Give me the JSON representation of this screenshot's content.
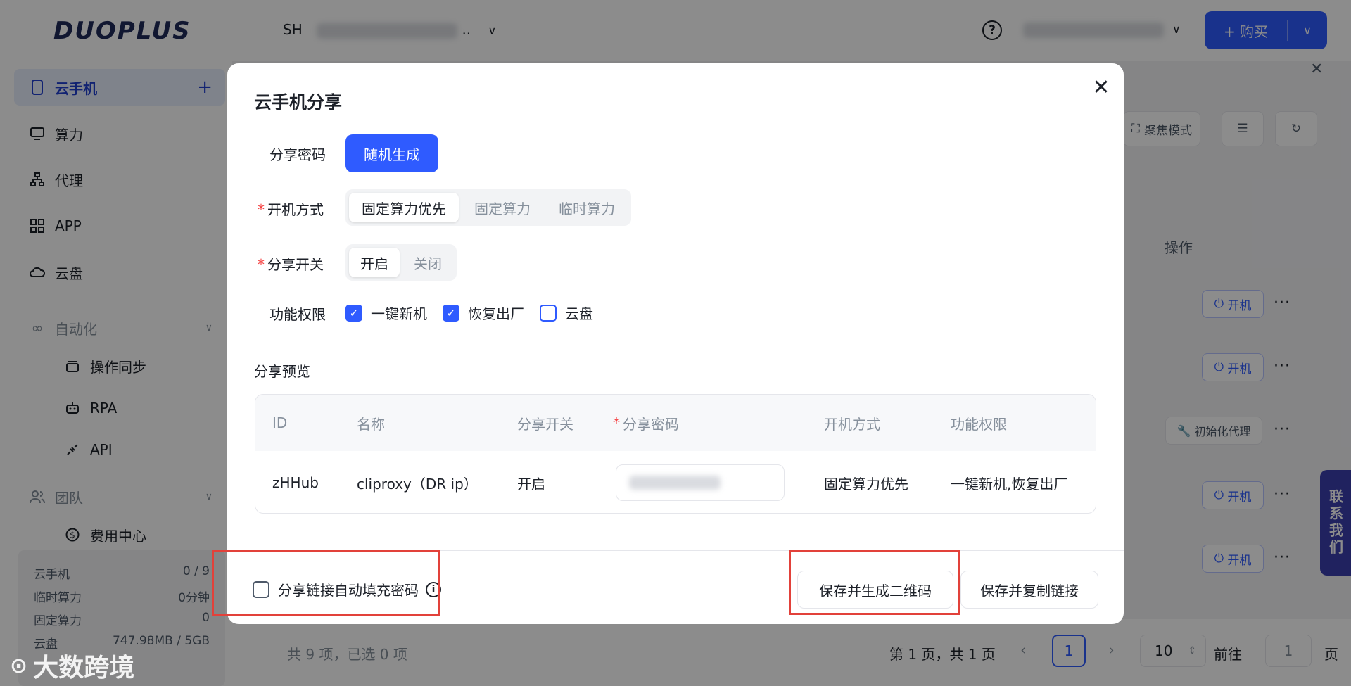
{
  "brand": "DUOPLUS",
  "sidebar": {
    "items": [
      {
        "label": "云手机",
        "icon": "phone-icon"
      },
      {
        "label": "算力",
        "icon": "monitor-icon"
      },
      {
        "label": "代理",
        "icon": "network-icon"
      },
      {
        "label": "APP",
        "icon": "grid-icon"
      },
      {
        "label": "云盘",
        "icon": "cloud-icon"
      },
      {
        "label": "自动化",
        "icon": "infinity-icon"
      },
      {
        "label": "操作同步",
        "icon": "layers-icon"
      },
      {
        "label": "RPA",
        "icon": "robot-icon"
      },
      {
        "label": "API",
        "icon": "plug-icon"
      },
      {
        "label": "团队",
        "icon": "team-icon"
      },
      {
        "label": "费用中心",
        "icon": "dollar-icon"
      }
    ],
    "stats": [
      {
        "label": "云手机",
        "value": "0 / 9"
      },
      {
        "label": "临时算力",
        "value": "0分钟"
      },
      {
        "label": "固定算力",
        "value": "0"
      },
      {
        "label": "云盘",
        "value": "747.98MB / 5GB"
      }
    ]
  },
  "topbar": {
    "region": "SH",
    "region_suffix": "..",
    "buy_label": "+ 购买"
  },
  "main": {
    "focus_mode": "聚焦模式",
    "ops_header": "操作",
    "power_label": "开机",
    "init_proxy_label": "初始化代理",
    "more": "···",
    "contact": "联系我们"
  },
  "pager": {
    "total": "共 9 项，已选 0 项",
    "info": "第 1 页，共 1 页",
    "current": "1",
    "size": "10",
    "goto": "前往",
    "goto_value": "1",
    "page_suffix": "页"
  },
  "modal": {
    "title": "云手机分享",
    "password_label": "分享密码",
    "random_btn": "随机生成",
    "boot_label": "开机方式",
    "boot_options": [
      "固定算力优先",
      "固定算力",
      "临时算力"
    ],
    "boot_selected": "固定算力优先",
    "switch_label": "分享开关",
    "switch_options": [
      "开启",
      "关闭"
    ],
    "perm_label": "功能权限",
    "perms": [
      {
        "label": "一键新机",
        "checked": true
      },
      {
        "label": "恢复出厂",
        "checked": true
      },
      {
        "label": "云盘",
        "checked": false
      }
    ],
    "preview_label": "分享预览",
    "table": {
      "headers": [
        "ID",
        "名称",
        "分享开关",
        "分享密码",
        "开机方式",
        "功能权限"
      ],
      "row": [
        "zHHub",
        "cliproxy（DR ip）",
        "开启",
        "",
        "固定算力优先",
        "一键新机,恢复出厂"
      ]
    },
    "autofill_label": "分享链接自动填充密码",
    "qr_btn": "保存并生成二维码",
    "copy_btn": "保存并复制链接"
  },
  "watermark": "大数跨境",
  "colors": {
    "primary": "#2f5bff",
    "highlight": "#e2413a",
    "required": "#f53f3f"
  }
}
